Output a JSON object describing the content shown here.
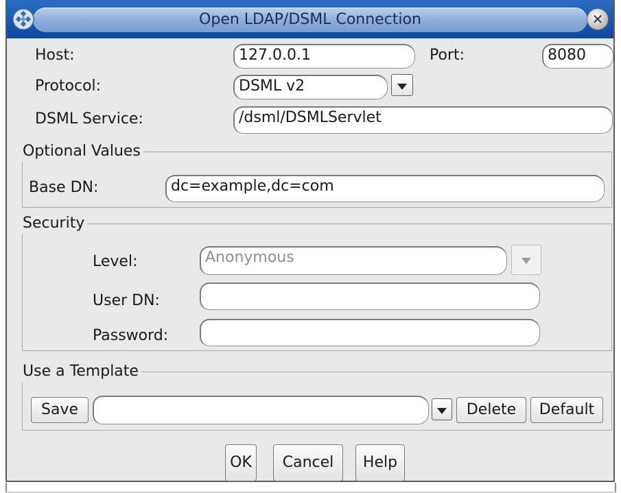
{
  "window": {
    "title": "Open LDAP/DSML Connection",
    "icon": "app-diamond-icon",
    "close_icon": "close-icon"
  },
  "connection": {
    "host_label": "Host:",
    "host_value": "127.0.0.1",
    "port_label": "Port:",
    "port_value": "8080",
    "protocol_label": "Protocol:",
    "protocol_value": "DSML v2",
    "dsml_service_label": "DSML Service:",
    "dsml_service_value": "/dsml/DSMLServlet"
  },
  "optional_values": {
    "title": "Optional Values",
    "base_dn_label": "Base DN:",
    "base_dn_value": "dc=example,dc=com"
  },
  "security": {
    "title": "Security",
    "level_label": "Level:",
    "level_value": "Anonymous",
    "user_dn_label": "User DN:",
    "user_dn_value": "",
    "password_label": "Password:",
    "password_value": ""
  },
  "template": {
    "title": "Use a Template",
    "save_label": "Save",
    "template_value": "",
    "delete_label": "Delete",
    "default_label": "Default"
  },
  "actions": {
    "ok_label": "OK",
    "cancel_label": "Cancel",
    "help_label": "Help"
  },
  "colors": {
    "titlebar": "#0c47a2",
    "title_pill": "#8eaedb",
    "window_bg": "#e9e9e9"
  }
}
